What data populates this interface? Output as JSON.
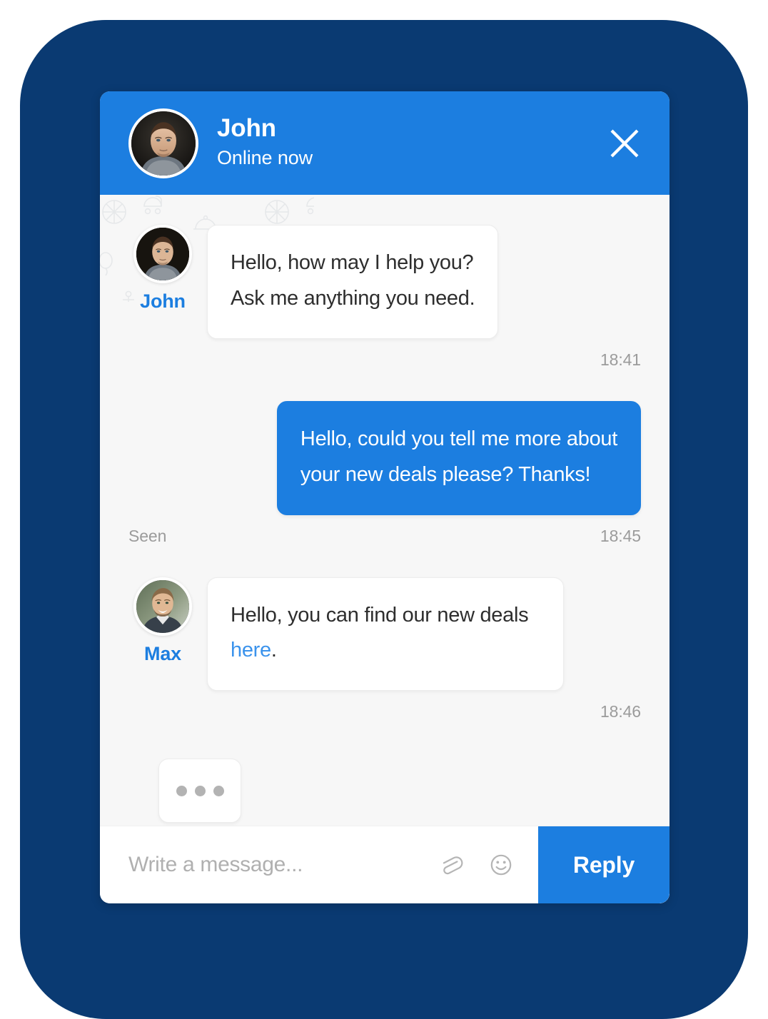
{
  "colors": {
    "backdrop_navy": "#0A3A72",
    "brand_blue": "#1C7EE0",
    "panel_background": "#F7F7F7",
    "bubble_in": "#FFFFFF",
    "link_blue": "#3B93EC",
    "meta_gray": "#9B9B9B"
  },
  "header": {
    "name": "John",
    "status": "Online now",
    "avatar_name": "john-avatar",
    "close_icon": "close-icon"
  },
  "conversation": {
    "messages": [
      {
        "id": "msg-1",
        "direction": "in",
        "sender": "John",
        "avatar_name": "john-avatar",
        "text": "Hello, how may I help you? Ask me anything you need.",
        "line1": "Hello, how may I help you?",
        "line2": "Ask me anything you need.",
        "time": "18:41",
        "seen": ""
      },
      {
        "id": "msg-2",
        "direction": "out",
        "sender": "",
        "text": "Hello, could you tell me more about your new deals please? Thanks!",
        "line1": "Hello, could you tell me more about",
        "line2": "your new deals please? Thanks!",
        "time": "18:45",
        "seen": "Seen"
      },
      {
        "id": "msg-3",
        "direction": "in",
        "sender": "Max",
        "avatar_name": "max-avatar",
        "text": "Hello, you can find our new deals here.",
        "text_before_link": "Hello, you can find our new deals ",
        "link_text": "here",
        "text_after_link": ".",
        "time": "18:46",
        "seen": ""
      }
    ],
    "typing_indicator": {
      "visible": true,
      "dots": 3
    }
  },
  "composer": {
    "input_value": "",
    "placeholder": "Write a message...",
    "attach_icon": "paperclip-icon",
    "emoji_icon": "smiley-icon",
    "reply_label": "Reply"
  }
}
